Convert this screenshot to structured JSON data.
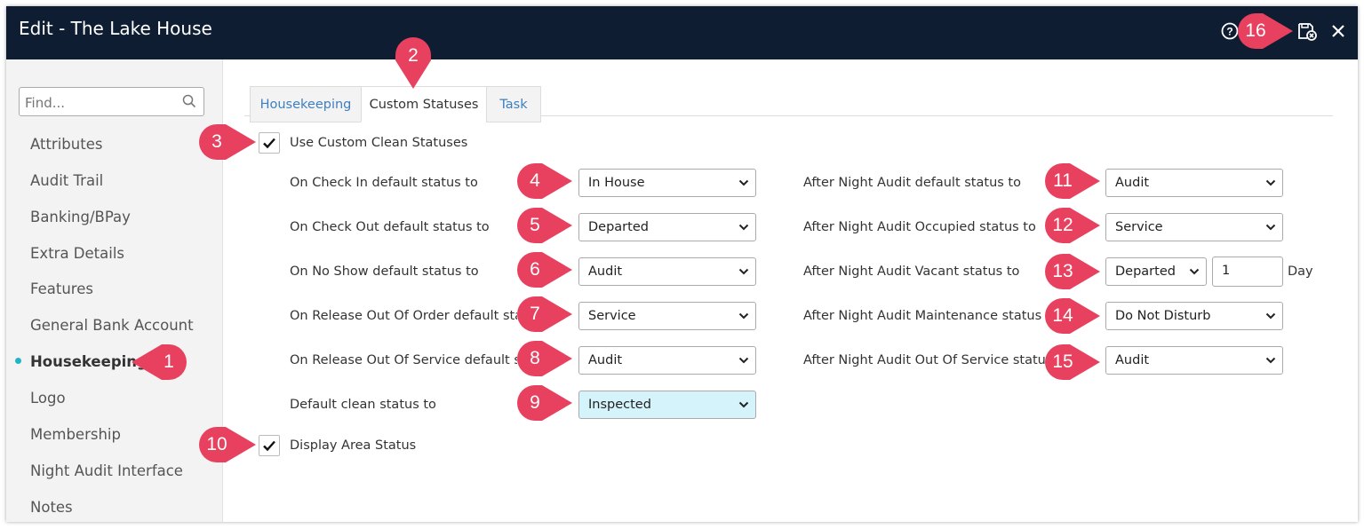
{
  "window": {
    "title": "Edit - The Lake House"
  },
  "toolbar": {
    "icons": [
      "help-icon",
      "save-close-icon",
      "close-icon"
    ]
  },
  "sidebar": {
    "search_placeholder": "Find...",
    "items": [
      {
        "label": "Attributes"
      },
      {
        "label": "Audit Trail"
      },
      {
        "label": "Banking/BPay"
      },
      {
        "label": "Extra Details"
      },
      {
        "label": "Features"
      },
      {
        "label": "General Bank Account"
      },
      {
        "label": "Housekeeping",
        "active": true
      },
      {
        "label": "Logo"
      },
      {
        "label": "Membership"
      },
      {
        "label": "Night Audit Interface"
      },
      {
        "label": "Notes"
      }
    ]
  },
  "tabs": [
    {
      "label": "Housekeeping"
    },
    {
      "label": "Custom Statuses",
      "active": true
    },
    {
      "label": "Task"
    }
  ],
  "form": {
    "use_custom": {
      "label": "Use Custom Clean Statuses",
      "checked": true
    },
    "display_area": {
      "label": "Display Area Status",
      "checked": true
    },
    "left": [
      {
        "label": "On Check In default status to",
        "value": "In House"
      },
      {
        "label": "On Check Out default status to",
        "value": "Departed"
      },
      {
        "label": "On No Show default status to",
        "value": "Audit"
      },
      {
        "label": "On Release Out Of Order default status to",
        "value": "Service"
      },
      {
        "label": "On Release Out Of Service default status to",
        "value": "Audit"
      },
      {
        "label": "Default clean status to",
        "value": "Inspected"
      }
    ],
    "right": [
      {
        "label": "After Night Audit default status to",
        "value": "Audit"
      },
      {
        "label": "After Night Audit Occupied status to",
        "value": "Service"
      },
      {
        "label": "After Night Audit Vacant status to",
        "value": "Departed"
      },
      {
        "label": "After Night Audit Maintenance status to",
        "value": "Do Not Disturb"
      },
      {
        "label": "After Night Audit Out Of Service status to",
        "value": "Audit"
      }
    ],
    "vacant_days": {
      "value": "1",
      "unit": "Day"
    }
  },
  "callouts": [
    "1",
    "2",
    "3",
    "4",
    "5",
    "6",
    "7",
    "8",
    "9",
    "10",
    "11",
    "12",
    "13",
    "14",
    "15",
    "16"
  ],
  "colors": {
    "titlebar": "#0f1d33",
    "marker": "#e8405f",
    "tab_link": "#3d7fbf",
    "active_dot": "#1fb5c8",
    "highlight_select": "#d4f3fa"
  }
}
